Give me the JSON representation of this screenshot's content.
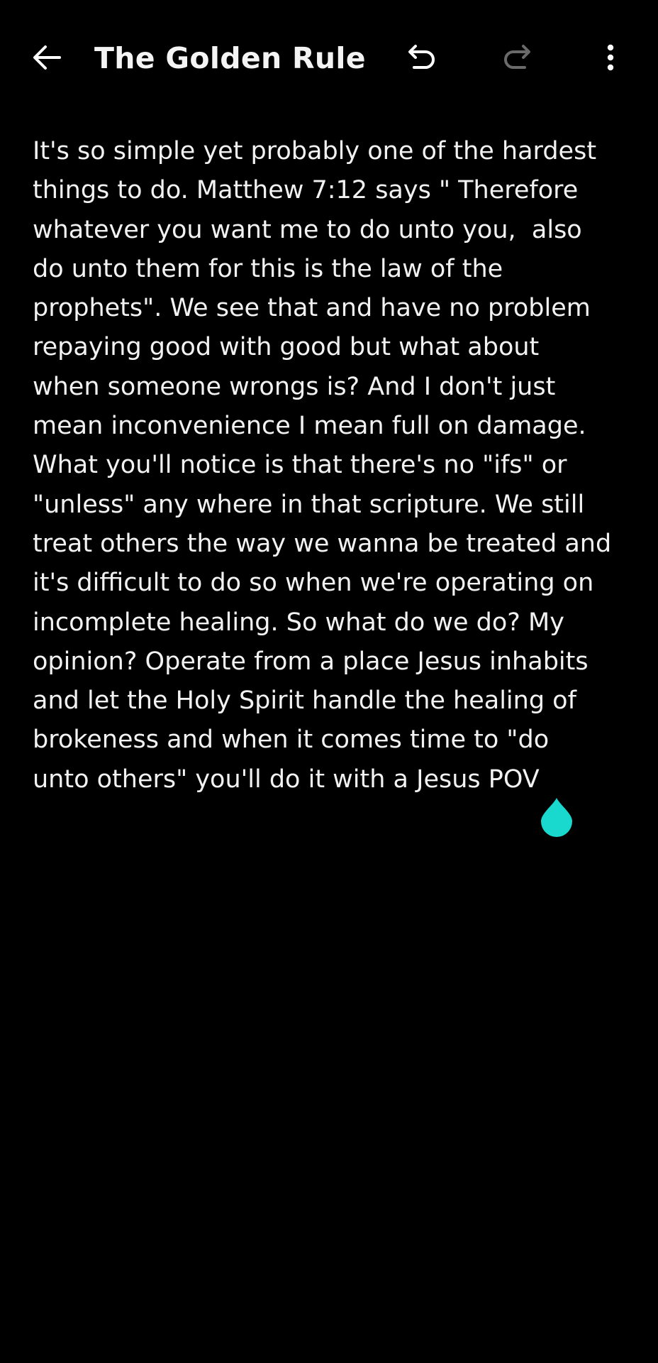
{
  "toolbar": {
    "title": "The Golden Rule",
    "back_icon": "arrow-left-icon",
    "undo_icon": "undo-icon",
    "redo_icon": "redo-icon",
    "more_icon": "more-vertical-icon",
    "redo_enabled": false
  },
  "note": {
    "lines": [
      "It's so simple yet probably one of the hardest",
      "things to do. Matthew 7:12 says \" Therefore",
      "whatever you want me to do unto you,  also",
      "do unto them for this is the law of the",
      "prophets\". We see that and have no problem",
      "repaying good with good but what about",
      "when someone wrongs is? And I don't just",
      "mean inconvenience I mean full on damage.",
      "What you'll notice is that there's no \"ifs\" or",
      "\"unless\" any where in that scripture. We still",
      "treat others the way we wanna be treated and",
      "it's difficult to do so when we're operating on",
      "incomplete healing. So what do we do? My",
      "opinion? Operate from a place Jesus inhabits",
      "and let the Holy Spirit handle the healing of",
      "brokeness and when it comes time to \"do",
      "unto others\" you'll do it with a Jesus POV"
    ]
  },
  "colors": {
    "background": "#000000",
    "text": "#f2f2f2",
    "icon": "#ffffff",
    "icon_disabled": "#6a6a6a",
    "cursor_handle": "#19d9cf"
  }
}
